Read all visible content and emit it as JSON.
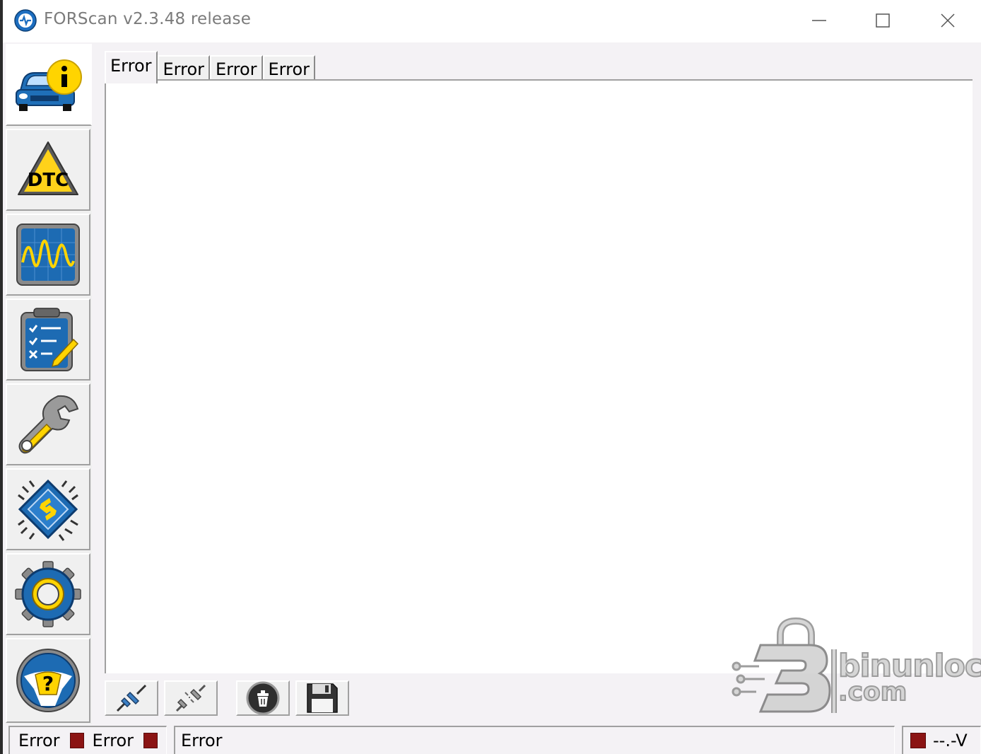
{
  "window": {
    "title": "FORScan v2.3.48 release"
  },
  "sidebar": {
    "items": [
      {
        "name": "vehicle-info",
        "icon": "car-info-icon",
        "active": true
      },
      {
        "name": "dtc",
        "icon": "dtc-warning-icon",
        "active": false
      },
      {
        "name": "oscilloscope",
        "icon": "oscilloscope-icon",
        "active": false
      },
      {
        "name": "tests",
        "icon": "checklist-icon",
        "active": false
      },
      {
        "name": "service",
        "icon": "wrench-icon",
        "active": false
      },
      {
        "name": "configuration",
        "icon": "chip-icon",
        "active": false
      },
      {
        "name": "settings",
        "icon": "gear-icon",
        "active": false
      },
      {
        "name": "help",
        "icon": "help-steering-wheel-icon",
        "active": false
      }
    ]
  },
  "tabs": [
    {
      "label": "Error",
      "active": true
    },
    {
      "label": "Error",
      "active": false
    },
    {
      "label": "Error",
      "active": false
    },
    {
      "label": "Error",
      "active": false
    }
  ],
  "toolbar": {
    "buttons": [
      {
        "icon": "connect-plug-icon"
      },
      {
        "icon": "disconnect-plug-icon"
      },
      {
        "icon": "clear-trash-icon"
      },
      {
        "icon": "save-floppy-icon"
      }
    ]
  },
  "watermark": {
    "line1": "binunlock",
    "line2": ".com"
  },
  "statusbar": {
    "left_label_1": "Error",
    "left_label_2": "Error",
    "message": "Error",
    "voltage": "--.-V",
    "led_color": "#8b1414"
  }
}
